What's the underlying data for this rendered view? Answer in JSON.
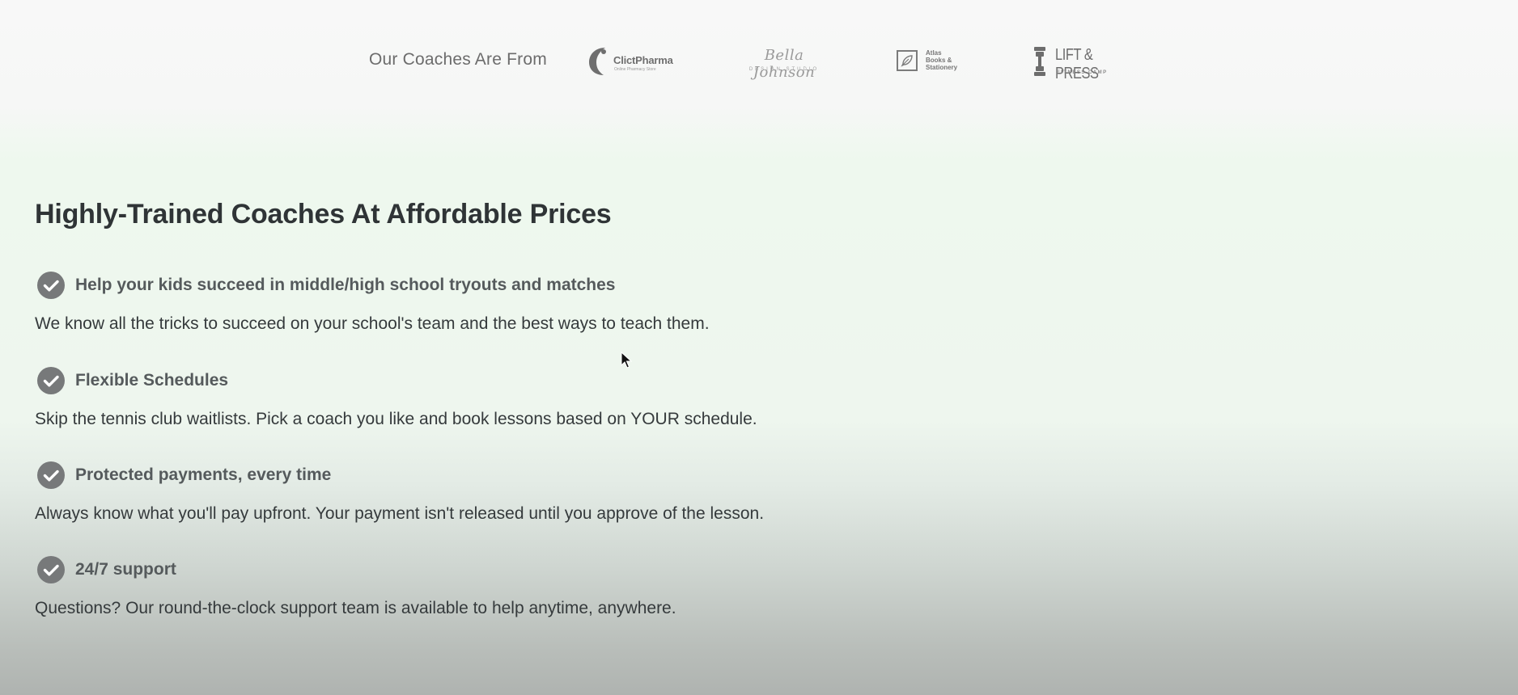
{
  "logos_section": {
    "label": "Our Coaches Are From",
    "logos": [
      {
        "name": "ClictPharma",
        "subtitle": "Online Pharmacy Store",
        "icon": "clictpharma-logo-icon"
      },
      {
        "name": "Bella Johnson",
        "subtitle": "DESIGN STUDIO"
      },
      {
        "name_lines": [
          "Atlas",
          "Books &",
          "Stationery"
        ],
        "icon": "feather-icon"
      },
      {
        "name": "LIFT & PRESS",
        "subtitle": "FITNESS CAMP",
        "icon": "dumbbell-icon"
      }
    ]
  },
  "headline": "Highly-Trained Coaches At Affordable Prices",
  "features": [
    {
      "icon": "check-circle-icon",
      "title": "Help your kids succeed in middle/high school tryouts and matches",
      "description": "We know all the tricks to succeed on your school's team and the best ways to teach them."
    },
    {
      "icon": "check-circle-icon",
      "title": "Flexible Schedules",
      "description": "Skip the tennis club waitlists. Pick a coach you like and book lessons based on YOUR schedule."
    },
    {
      "icon": "check-circle-icon",
      "title": "Protected payments, every time",
      "description": "Always know what you'll pay upfront. Your payment isn't released until you approve of the lesson."
    },
    {
      "icon": "check-circle-icon",
      "title": "24/7 support",
      "description": "Questions? Our round-the-clock support team is available to help anytime, anywhere."
    }
  ],
  "colors": {
    "headline": "#2f3436",
    "feature_title": "#555a5c",
    "body_text": "#353a3c",
    "check_icon": "#77797a",
    "logo_gray": "#7d7d7d"
  }
}
